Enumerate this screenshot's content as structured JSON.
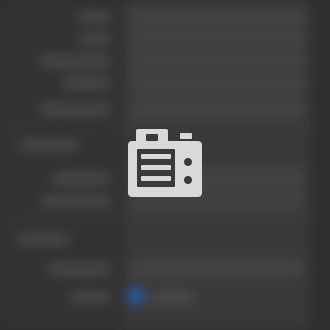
{
  "screen": {
    "state": "loading-blurred-settings",
    "center_icon": "camera-icon"
  },
  "colors": {
    "background": "#2f2f2f",
    "icon_fill": "#d9d9d9",
    "icon_detail": "#3a3a3a",
    "accent_blurred": "#2b5fb0"
  }
}
